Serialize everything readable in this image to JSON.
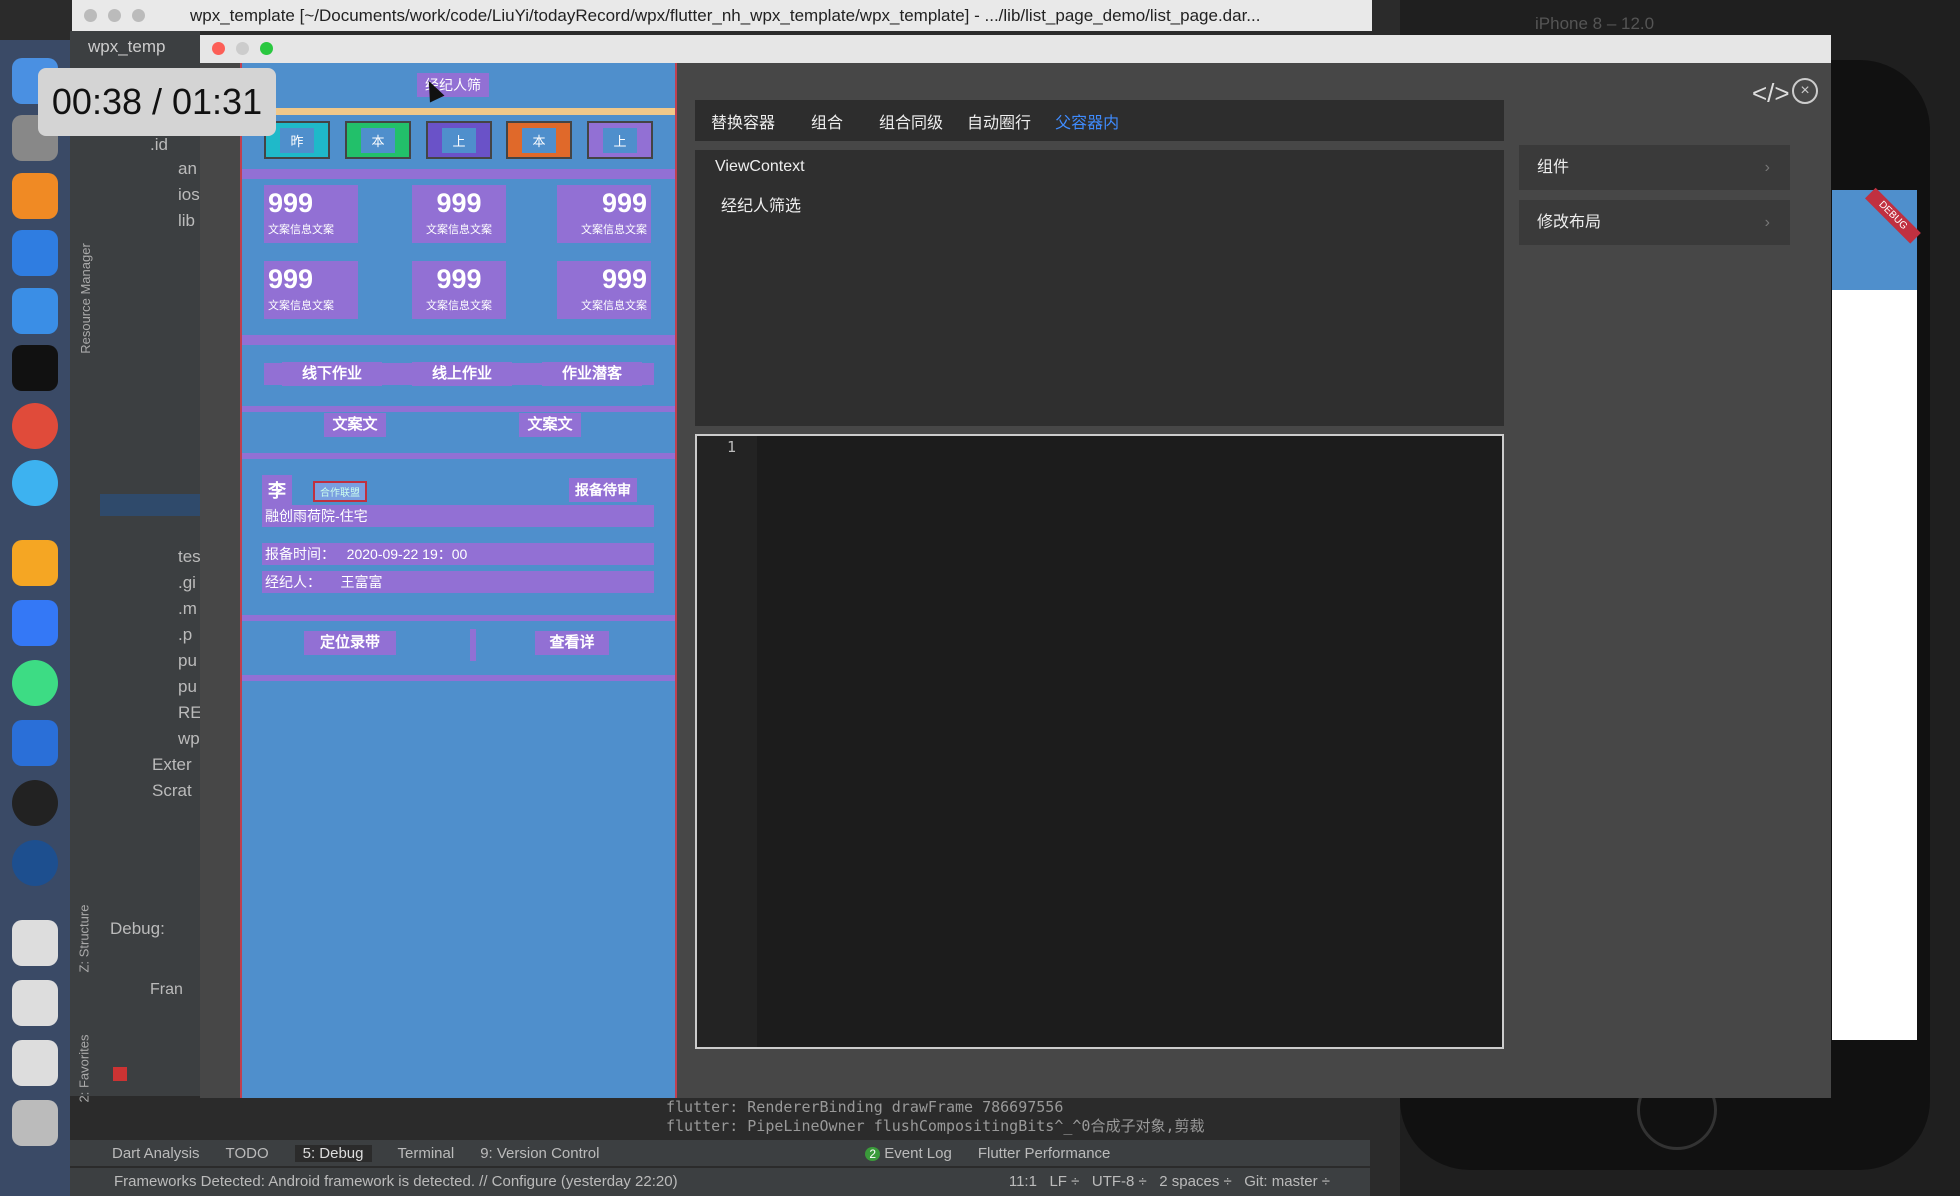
{
  "window_title": "wpx_template [~/Documents/work/code/LiuYi/todayRecord/wpx/flutter_nh_wpx_template/wpx_template] - .../lib/list_page_demo/list_page.dar...",
  "ide_tab": "wpx_temp",
  "simulator_title": "iPhone 8 – 12.0",
  "video_timer": "00:38 / 01:31",
  "project_tree": [
    ".id",
    "an",
    "ios",
    "lib",
    "tes",
    ".gi",
    ".m",
    ".p",
    "pu",
    "pu",
    "RE",
    "wp",
    "Exter",
    "Scrat"
  ],
  "side_labels": {
    "resource_manager": "Resource Manager",
    "structure": "Z: Structure",
    "favorites": "2: Favorites",
    "debug": "Debug:",
    "frames": "Fran"
  },
  "preview": {
    "header": "经纪人筛",
    "tags": [
      {
        "label": "昨",
        "color": "#1fb9c9"
      },
      {
        "label": "本",
        "color": "#22c06a"
      },
      {
        "label": "上",
        "color": "#6a52c8"
      },
      {
        "label": "本",
        "color": "#e0692a"
      },
      {
        "label": "上",
        "color": "#9270d4"
      }
    ],
    "stats": [
      {
        "value": "999",
        "label": "文案信息文案"
      },
      {
        "value": "999",
        "label": "文案信息文案"
      },
      {
        "value": "999",
        "label": "文案信息文案"
      },
      {
        "value": "999",
        "label": "文案信息文案"
      },
      {
        "value": "999",
        "label": "文案信息文案"
      },
      {
        "value": "999",
        "label": "文案信息文案"
      }
    ],
    "work_tabs": [
      "线下作业",
      "线上作业",
      "作业潜客"
    ],
    "text_buttons": [
      "文案文",
      "文案文"
    ],
    "card": {
      "surname": "李",
      "badge": "合作联盟",
      "status": "报备待审",
      "project": "融创雨荷院-住宅",
      "time_label": "报备时间：",
      "time_value": "2020-09-22 19：00",
      "agent_label": "经纪人：",
      "agent_value": "王富富"
    },
    "actions": [
      "定位录带",
      "查看详"
    ]
  },
  "inspector": {
    "tabs": [
      "替换容器",
      "组合",
      "组合同级",
      "自动圈行",
      "父容器内"
    ],
    "active_tab": 4,
    "context_title": "ViewContext",
    "context_item": "经纪人筛选",
    "line_number": "1",
    "side_buttons": [
      "组件",
      "修改布局"
    ]
  },
  "console": [
    "flutter: RendererBinding drawFrame 786697556",
    "flutter: PipeLineOwner flushCompositingBits^_^0合成子对象,剪裁"
  ],
  "toolbar": [
    "Dart Analysis",
    "TODO",
    "5: Debug",
    "Terminal",
    "9: Version Control",
    "Event Log",
    "Flutter Performance"
  ],
  "event_count": "2",
  "status": {
    "message": "Frameworks Detected: Android framework is detected. // Configure (yesterday 22:20)",
    "position": "11:1",
    "line_sep": "LF ÷",
    "encoding": "UTF-8 ÷",
    "indent": "2 spaces ÷",
    "git": "Git: master ÷"
  },
  "debug_badge": "DEBUG"
}
